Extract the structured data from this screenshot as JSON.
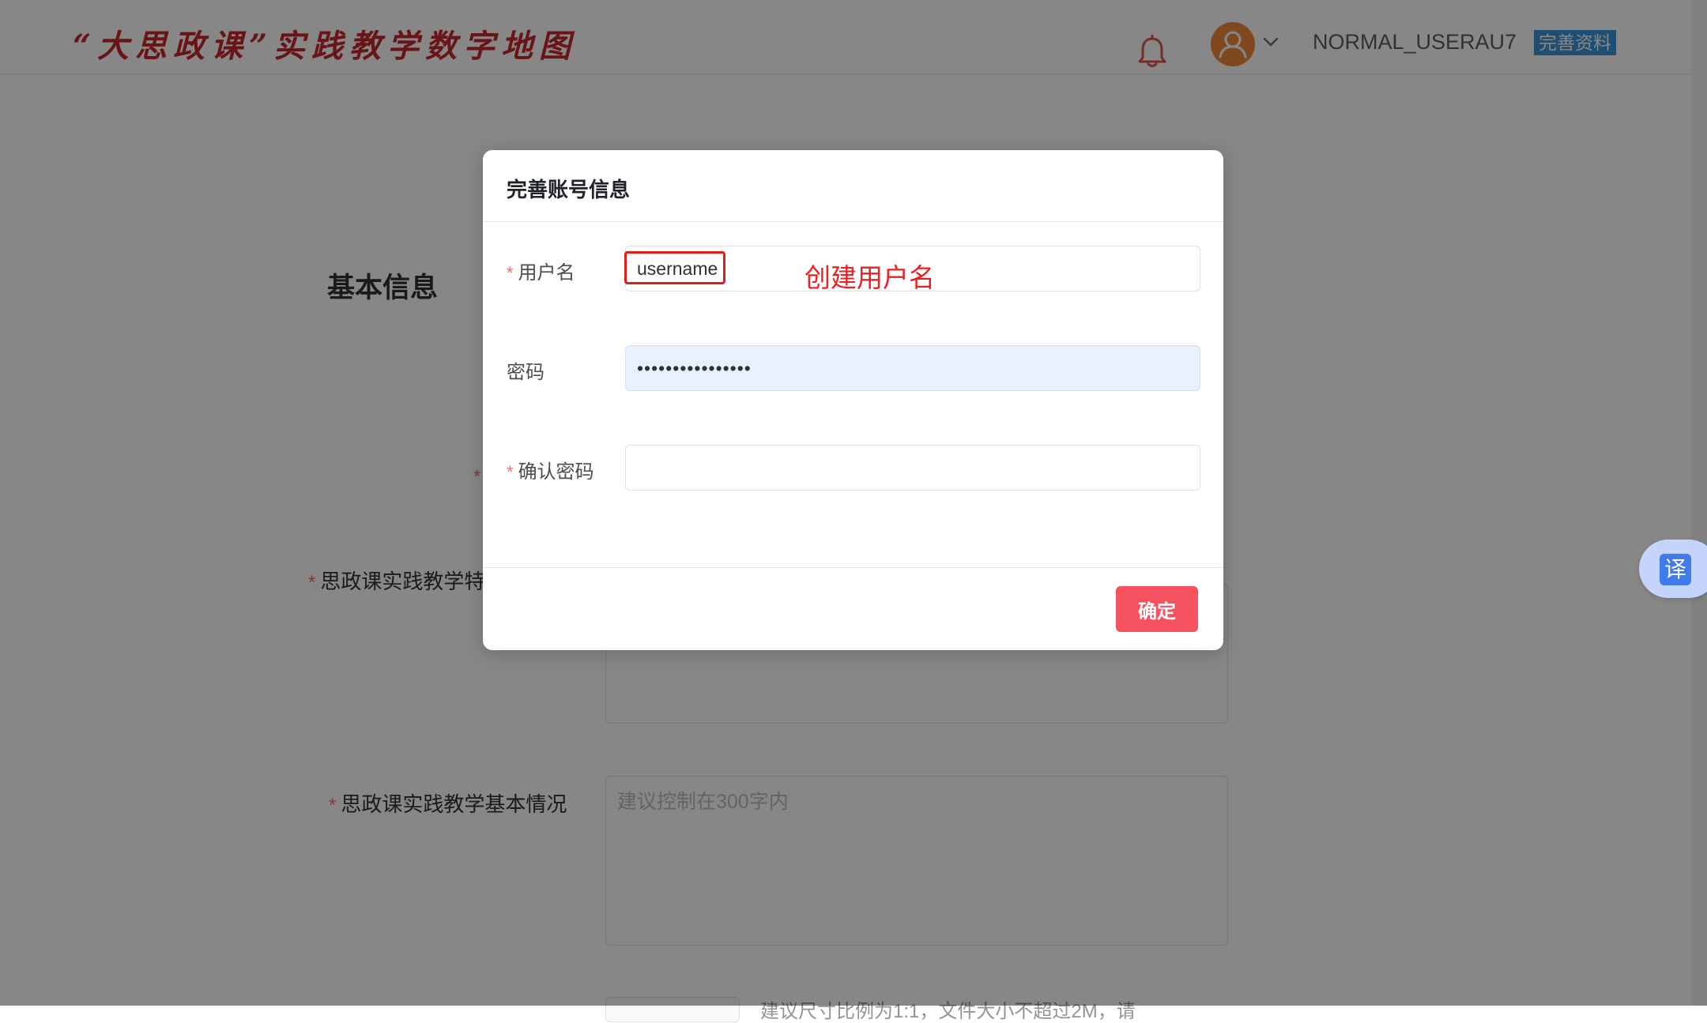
{
  "header": {
    "logo_text": "“大思政课”实践教学数字地图",
    "user_name": "NORMAL_USERAU7",
    "complete_profile_tag": "完善资料",
    "icons": [
      "bell-icon",
      "user-avatar-icon",
      "chevron-down-icon"
    ]
  },
  "background_form": {
    "section_title": "基本信息",
    "required_mark": "*",
    "field_features_label": "思政课实践教学特",
    "field_basic_label": "思政课实践教学基本情况",
    "basic_placeholder": "建议控制在300字内",
    "upload_hint": "建议尺寸比例为1:1，文件大小不超过2M，请"
  },
  "translate_widget": {
    "glyph": "译",
    "icon": "translate-icon"
  },
  "dialog": {
    "title": "完善账号信息",
    "required_mark": "*",
    "username": {
      "label": "用户名",
      "value": "username",
      "annotation": "创建用户名"
    },
    "password": {
      "label": "密码",
      "value": "••••••••••••••••"
    },
    "confirm_password": {
      "label": "确认密码",
      "value": ""
    },
    "confirm_button": "确定"
  },
  "colors": {
    "logo": "#c7282d",
    "tag_bg": "#3a93d8",
    "required": "#f56c6c",
    "confirm_button": "#f5515f",
    "annotation": "#ec2020",
    "autofill_bg": "#e8f0fe"
  }
}
